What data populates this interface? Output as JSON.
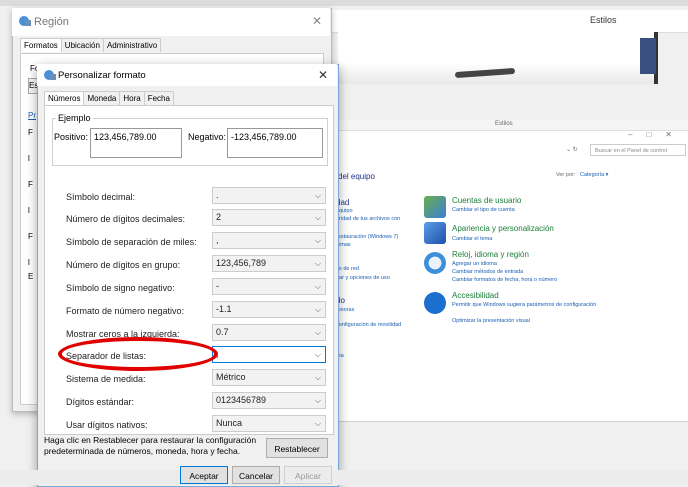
{
  "background": {
    "estilos_title": "Estilos",
    "estilos_title_small": "Estilos"
  },
  "control_panel": {
    "search_placeholder": "Buscar en el Panel de control",
    "heading": "del equipo",
    "view_by_label": "Ver por:",
    "view_by_value": "Categoría ▾",
    "left_items": [
      "dad",
      "equipo",
      "uridad de tus archivos con",
      "restauración (Windows 7)",
      "lemas",
      "as de red",
      "gar y opciones de uso",
      "do",
      "resoras",
      "configuración de movilidad",
      "ma"
    ],
    "categories": [
      {
        "title": "Cuentas de usuario",
        "subs": [
          "Cambiar el tipo de cuenta"
        ],
        "icon": "users-icon",
        "color": "#3b7dd8"
      },
      {
        "title": "Apariencia y personalización",
        "subs": [
          "Cambiar el tema"
        ],
        "icon": "appearance-icon",
        "color": "#2a6fc9"
      },
      {
        "title": "Reloj, idioma y región",
        "subs": [
          "Agregar un idioma",
          "Cambiar métodos de entrada",
          "Cambiar formatos de fecha, hora o número"
        ],
        "icon": "clock-globe-icon",
        "color": "#3c8fd8"
      },
      {
        "title": "Accesibilidad",
        "subs": [
          "Permitir que Windows sugiera parámetros de configuración",
          "Optimizar la presentación visual"
        ],
        "icon": "accessibility-icon",
        "color": "#1a6fcf"
      }
    ]
  },
  "region": {
    "title": "Región",
    "tabs": [
      "Formatos",
      "Ubicación",
      "Administrativo"
    ],
    "peek_labels": [
      "Fo",
      "Es",
      "Pr",
      "F",
      "l",
      "F",
      "l",
      "F",
      "l",
      "E"
    ]
  },
  "custom_format": {
    "title": "Personalizar formato",
    "tabs": [
      "Números",
      "Moneda",
      "Hora",
      "Fecha"
    ],
    "example_label": "Ejemplo",
    "positive_label": "Positivo:",
    "positive_value": "123,456,789.00",
    "negative_label": "Negativo:",
    "negative_value": "-123,456,789.00",
    "rows": [
      {
        "label": "Símbolo decimal:",
        "value": "."
      },
      {
        "label": "Número de dígitos decimales:",
        "value": "2"
      },
      {
        "label": "Símbolo de separación de miles:",
        "value": ","
      },
      {
        "label": "Número de dígitos en grupo:",
        "value": "123,456,789"
      },
      {
        "label": "Símbolo de signo negativo:",
        "value": "-"
      },
      {
        "label": "Formato de número negativo:",
        "value": "-1.1"
      },
      {
        "label": "Mostrar ceros a la izquierda:",
        "value": "0.7"
      },
      {
        "label": "Separador de listas:",
        "value": ","
      },
      {
        "label": "Sistema de medida:",
        "value": "Métrico"
      },
      {
        "label": "Dígitos estándar:",
        "value": "0123456789"
      },
      {
        "label": "Usar dígitos nativos:",
        "value": "Nunca"
      }
    ],
    "hint": "Haga clic en Restablecer para restaurar la configuración predeterminada de números, moneda, hora y fecha.",
    "reset_label": "Restablecer",
    "accept_label": "Aceptar",
    "cancel_label": "Cancelar",
    "apply_label": "Aplicar"
  },
  "annotation_color": "#e00000"
}
